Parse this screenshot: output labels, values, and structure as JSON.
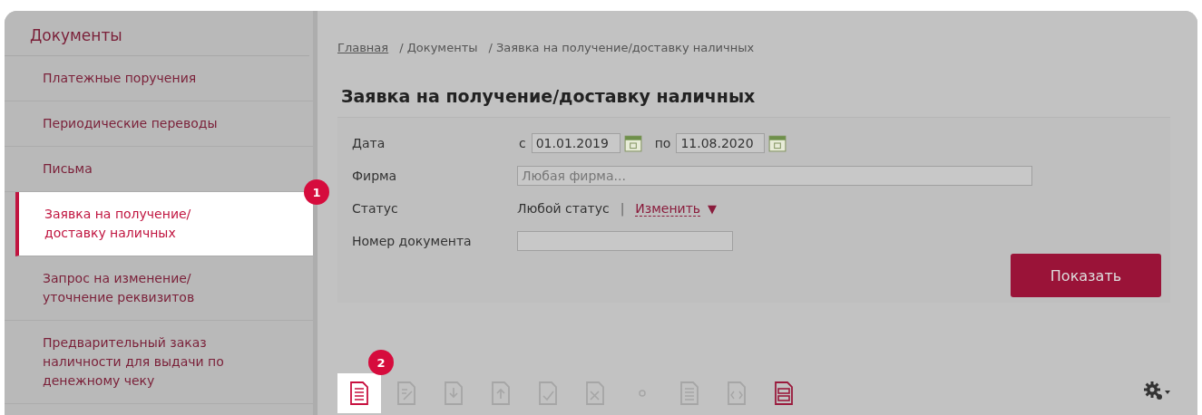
{
  "sidebar": {
    "title": "Документы",
    "items": [
      {
        "label": "Платежные поручения",
        "selected": false
      },
      {
        "label": "Периодические переводы",
        "selected": false
      },
      {
        "label": "Письма",
        "selected": false
      },
      {
        "label": "Заявка на получение/доставку наличных",
        "selected": true,
        "badge": "1"
      },
      {
        "label": "Запрос на изменение/уточнение реквизитов",
        "selected": false
      },
      {
        "label": "Предварительный заказ наличности для выдачи по денежному чеку",
        "selected": false
      }
    ]
  },
  "breadcrumb": [
    {
      "label": "Главная",
      "link": true
    },
    {
      "label": "/ Документы",
      "link": false
    },
    {
      "label": "/ Заявка на получение/доставку наличных",
      "link": false
    }
  ],
  "title": "Заявка на получение/доставку наличных",
  "filter": {
    "date_label": "Дата",
    "from_prefix": "с",
    "from_value": "01.01.2019",
    "to_prefix": "по",
    "to_value": "11.08.2020",
    "firm_label": "Фирма",
    "firm_placeholder": "Любая фирма...",
    "status_label": "Статус",
    "status_value": "Любой статус",
    "status_separator": "|",
    "status_change": "Изменить",
    "status_caret": "▼",
    "number_label": "Номер документа",
    "show_button": "Показать"
  },
  "toolbar": [
    {
      "kind": "new",
      "disabled": false,
      "highlighted": true,
      "badge": "2"
    },
    {
      "kind": "edit",
      "disabled": true,
      "highlighted": false
    },
    {
      "kind": "import",
      "disabled": true,
      "highlighted": false
    },
    {
      "kind": "export",
      "disabled": true,
      "highlighted": false
    },
    {
      "kind": "sign",
      "disabled": true,
      "highlighted": false
    },
    {
      "kind": "unsign",
      "disabled": true,
      "highlighted": false
    },
    {
      "kind": "dot",
      "disabled": true,
      "highlighted": false
    },
    {
      "kind": "list",
      "disabled": true,
      "highlighted": false
    },
    {
      "kind": "xml",
      "disabled": true,
      "highlighted": false
    },
    {
      "kind": "print",
      "disabled": false,
      "highlighted": false
    }
  ]
}
